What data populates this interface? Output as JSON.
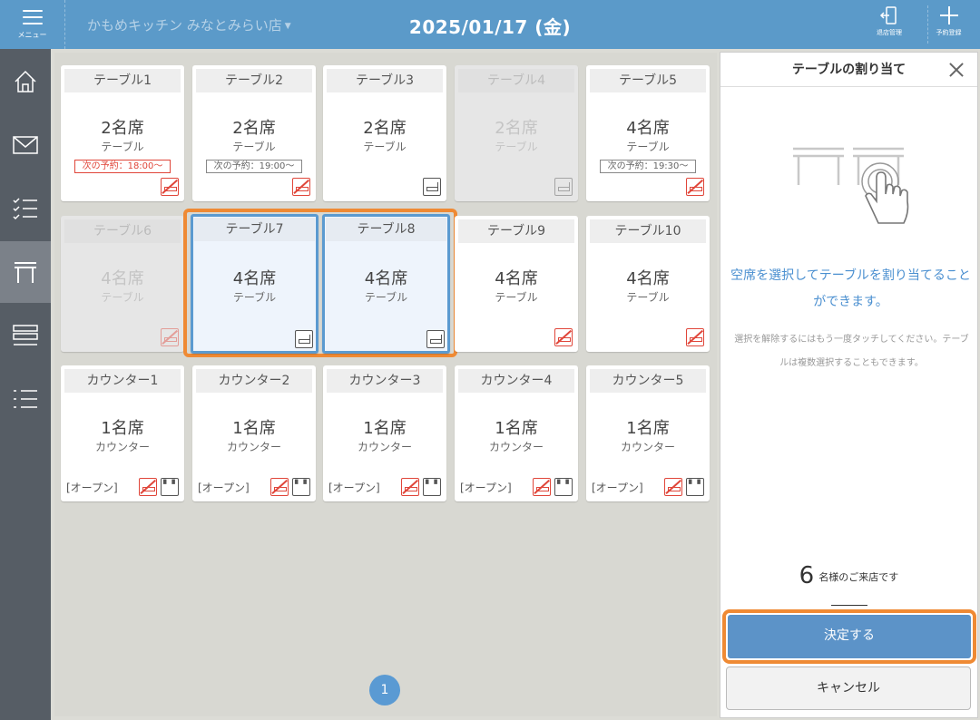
{
  "header": {
    "menu_label": "メニュー",
    "store_name": "かもめキッチン みなとみらい店",
    "date": "2025/01/17 (金)",
    "exit_label": "退店管理",
    "add_label": "予約登録"
  },
  "tables": [
    {
      "title": "テーブル1",
      "seats": "2名席",
      "type": "テーブル",
      "next": "次の予約：18:00～"
    },
    {
      "title": "テーブル2",
      "seats": "2名席",
      "type": "テーブル",
      "next": "次の予約：19:00～"
    },
    {
      "title": "テーブル3",
      "seats": "2名席",
      "type": "テーブル"
    },
    {
      "title": "テーブル4",
      "seats": "2名席",
      "type": "テーブル"
    },
    {
      "title": "テーブル5",
      "seats": "4名席",
      "type": "テーブル",
      "next": "次の予約：19:30～"
    },
    {
      "title": "テーブル6",
      "seats": "4名席",
      "type": "テーブル"
    },
    {
      "title": "テーブル7",
      "seats": "4名席",
      "type": "テーブル"
    },
    {
      "title": "テーブル8",
      "seats": "4名席",
      "type": "テーブル"
    },
    {
      "title": "テーブル9",
      "seats": "4名席",
      "type": "テーブル"
    },
    {
      "title": "テーブル10",
      "seats": "4名席",
      "type": "テーブル"
    },
    {
      "title": "カウンター1",
      "seats": "1名席",
      "type": "カウンター",
      "status": "[オープン]"
    },
    {
      "title": "カウンター2",
      "seats": "1名席",
      "type": "カウンター",
      "status": "[オープン]"
    },
    {
      "title": "カウンター3",
      "seats": "1名席",
      "type": "カウンター",
      "status": "[オープン]"
    },
    {
      "title": "カウンター4",
      "seats": "1名席",
      "type": "カウンター",
      "status": "[オープン]"
    },
    {
      "title": "カウンター5",
      "seats": "1名席",
      "type": "カウンター",
      "status": "[オープン]"
    }
  ],
  "pagination": {
    "current": "1"
  },
  "panel": {
    "title": "テーブルの割り当て",
    "main_message": "空席を選択してテーブルを割り当てることができます。",
    "sub_message": "選択を解除するにはもう一度タッチしてください。テーブルは複数選択することもできます。",
    "guest_count": "6",
    "guest_unit": "名様のご来店です",
    "confirm_label": "決定する",
    "cancel_label": "キャンセル"
  },
  "colors": {
    "header": "#5b9ac9",
    "sidebar": "#565d65",
    "selected_outline": "#ef8a34",
    "selected_border": "#5b9ad0",
    "warning": "#e0463a"
  }
}
